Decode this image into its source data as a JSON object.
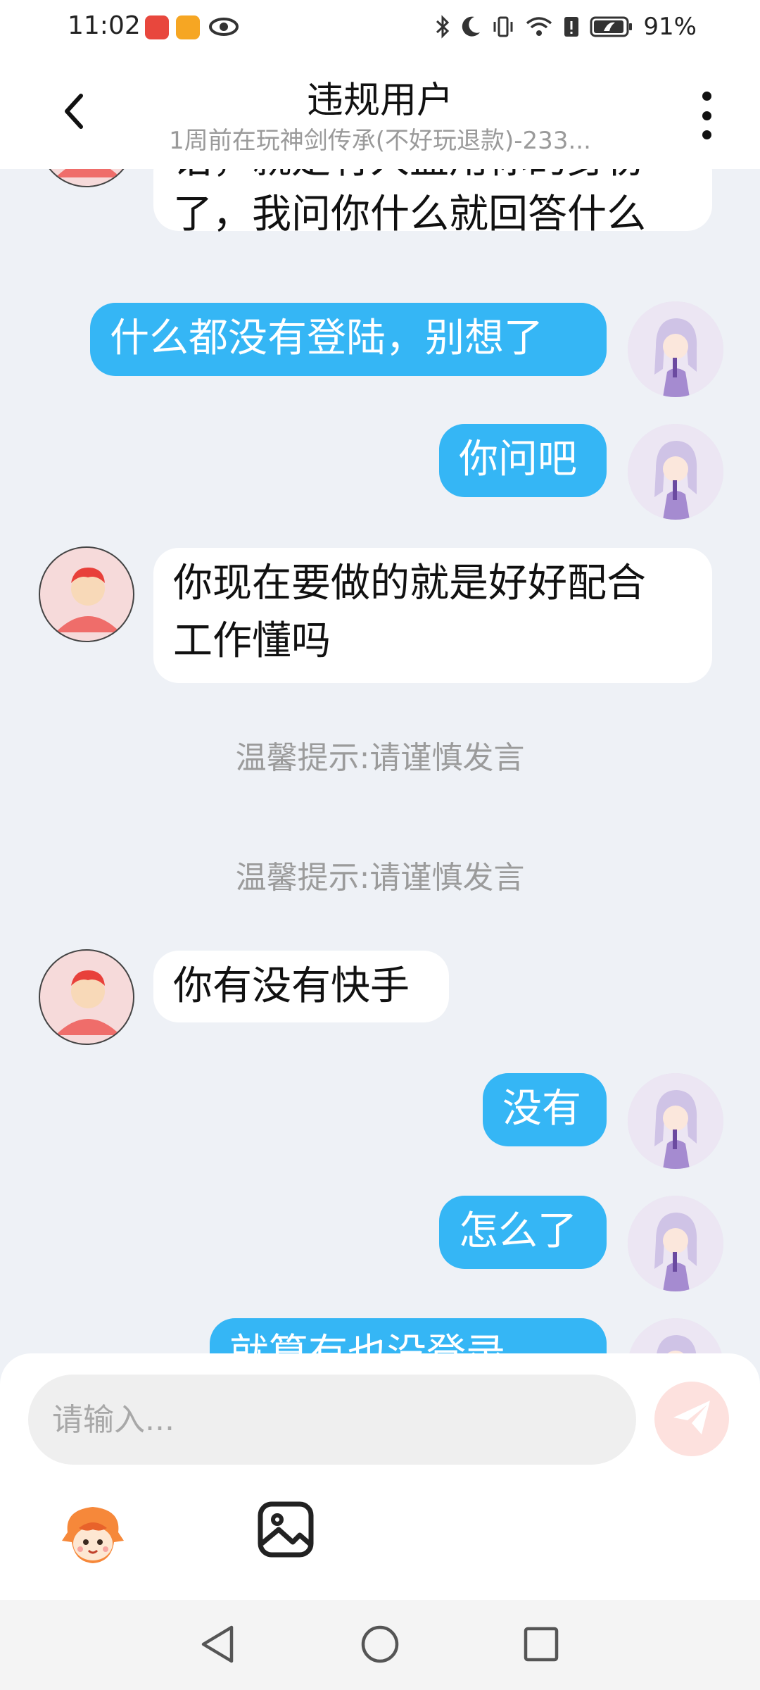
{
  "status_bar": {
    "time": "11:02",
    "battery": "91%"
  },
  "header": {
    "title": "违规用户",
    "subtitle": "1周前在玩神剑传承(不好玩退款)-233..."
  },
  "messages": [
    {
      "side": "in",
      "lines": [
        "话，就是有人盗用你的身份",
        "了，我问你什么就回答什么"
      ]
    },
    {
      "side": "out",
      "text": "什么都没有登陆，别想了"
    },
    {
      "side": "out",
      "text": "你问吧"
    },
    {
      "side": "in",
      "lines": [
        "你现在要做的就是好好配合",
        "工作懂吗"
      ]
    },
    {
      "side": "tip",
      "text": "温馨提示:请谨慎发言"
    },
    {
      "side": "tip",
      "text": "温馨提示:请谨慎发言"
    },
    {
      "side": "in",
      "text": "你有没有快手"
    },
    {
      "side": "out",
      "text": "没有"
    },
    {
      "side": "out",
      "text": "怎么了"
    },
    {
      "side": "out",
      "text": "就算有也没登录"
    }
  ],
  "composer": {
    "placeholder": "请输入..."
  },
  "icons": {
    "back": "chevron-left-icon",
    "more": "more-vertical-icon",
    "send": "paper-plane-icon",
    "emoji": "sticker-icon",
    "image": "image-icon",
    "nav": [
      "back-triangle-icon",
      "home-circle-icon",
      "recents-square-icon"
    ]
  },
  "colors": {
    "outgoing_bubble": "#35b6f5",
    "incoming_bubble": "#ffffff",
    "chat_background": "#eef1f6",
    "send_button": "#fde1de"
  }
}
